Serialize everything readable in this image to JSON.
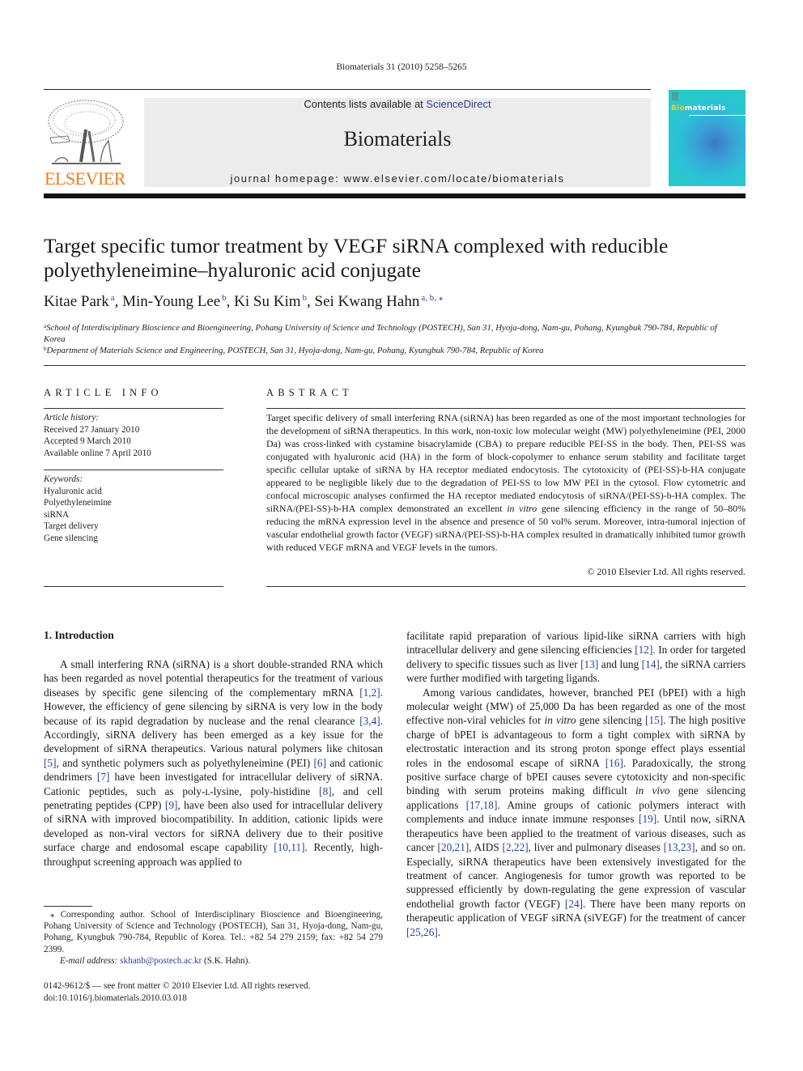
{
  "header": {
    "citation": "Biomaterials 31 (2010) 5258–5265",
    "contents_prefix": "Contents lists available at ",
    "contents_link": "ScienceDirect",
    "journal_name": "Biomaterials",
    "homepage": "journal homepage: www.elsevier.com/locate/biomaterials",
    "publisher_logo_text": "ELSEVIER",
    "cover_title_highlight": "Bio",
    "cover_title_rest": "materials",
    "colors": {
      "publisher_orange": "#f07c1a",
      "link_blue": "#2a3f9a",
      "masthead_bg": "#ececec",
      "cover_teal": "#28c4c6"
    }
  },
  "article": {
    "title_line1": "Target specific tumor treatment by VEGF siRNA complexed with reducible",
    "title_line2": "polyethyleneimine–hyaluronic acid conjugate",
    "authors": [
      {
        "name": "Kitae Park",
        "affil": "a"
      },
      {
        "name": "Min-Young Lee",
        "affil": "b"
      },
      {
        "name": "Ki Su Kim",
        "affil": "b"
      },
      {
        "name": "Sei Kwang Hahn",
        "affil": "a, b, ⁎"
      }
    ],
    "affiliations": [
      {
        "mark": "a",
        "text": "School of Interdisciplinary Bioscience and Bioengineering, Pohang University of Science and Technology (POSTECH), San 31, Hyoja-dong, Nam-gu, Pohang, Kyungbuk 790-784, Republic of Korea"
      },
      {
        "mark": "b",
        "text": "Department of Materials Science and Engineering, POSTECH, San 31, Hyoja-dong, Nam-gu, Pohang, Kyungbuk 790-784, Republic of Korea"
      }
    ]
  },
  "article_info": {
    "heading": "ARTICLE INFO",
    "history_label": "Article history:",
    "history": [
      "Received 27 January 2010",
      "Accepted 9 March 2010",
      "Available online 7 April 2010"
    ],
    "keywords_label": "Keywords:",
    "keywords": [
      "Hyaluronic acid",
      "Polyethyleneimine",
      "siRNA",
      "Target delivery",
      "Gene silencing"
    ]
  },
  "abstract": {
    "heading": "ABSTRACT",
    "text_part1": "Target specific delivery of small interfering RNA (siRNA) has been regarded as one of the most important technologies for the development of siRNA therapeutics. In this work, non-toxic low molecular weight (MW) polyethyleneimine (PEI, 2000 Da) was cross-linked with cystamine bisacrylamide (CBA) to prepare reducible PEI-SS in the body. Then, PEI-SS was conjugated with hyaluronic acid (HA) in the form of block-copolymer to enhance serum stability and facilitate target specific cellular uptake of siRNA by HA receptor mediated endocytosis. The cytotoxicity of (PEI-SS)-b-HA conjugate appeared to be negligible likely due to the degradation of PEI-SS to low MW PEI in the cytosol. Flow cytometric and confocal microscopic analyses confirmed the HA receptor mediated endocytosis of siRNA/(PEI-SS)-b-HA complex. The siRNA/(PEI-SS)-b-HA complex demonstrated an excellent ",
    "text_italic": "in vitro",
    "text_part2": " gene silencing efficiency in the range of 50–80% reducing the mRNA expression level in the absence and presence of 50 vol% serum. Moreover, intra-tumoral injection of vascular endothelial growth factor (VEGF) siRNA/(PEI-SS)-b-HA complex resulted in dramatically inhibited tumor growth with reduced VEGF mRNA and VEGF levels in the tumors.",
    "copyright": "© 2010 Elsevier Ltd. All rights reserved."
  },
  "introduction": {
    "heading": "1.  Introduction",
    "col1": [
      "A small interfering RNA (siRNA) is a short double-stranded RNA which has been regarded as novel potential therapeutics for the treatment of various diseases by specific gene silencing of the complementary mRNA ",
      "[1,2]",
      ". However, the efficiency of gene silencing by siRNA is very low in the body because of its rapid degradation by nuclease and the renal clearance ",
      "[3,4]",
      ". Accordingly, siRNA delivery has been emerged as a key issue for the development of siRNA therapeutics. Various natural polymers like chitosan ",
      "[5]",
      ", and synthetic polymers such as polyethyleneimine (PEI) ",
      "[6]",
      " and cationic dendrimers ",
      "[7]",
      " have been investigated for intracellular delivery of siRNA. Cationic peptides, such as poly-ʟ-lysine, poly-histidine ",
      "[8]",
      ", and cell penetrating peptides (CPP) ",
      "[9]",
      ", have been also used for intracellular delivery of siRNA with improved biocompatibility. In addition, cationic lipids were developed as non-viral vectors for siRNA delivery due to their positive surface charge and endosomal escape capability ",
      "[10,11]",
      ". Recently, high-throughput screening approach was applied to"
    ],
    "col2_para1": [
      "facilitate rapid preparation of various lipid-like siRNA carriers with high intracellular delivery and gene silencing efficiencies ",
      "[12]",
      ". In order for targeted delivery to specific tissues such as liver ",
      "[13]",
      " and lung ",
      "[14]",
      ", the siRNA carriers were further modified with targeting ligands."
    ],
    "col2_para2": [
      "Among various candidates, however, branched PEI (bPEI) with a high molecular weight (MW) of 25,000 Da has been regarded as one of the most effective non-viral vehicles for ",
      "in vitro",
      " gene silencing ",
      "[15]",
      ". The high positive charge of bPEI is advantageous to form a tight complex with siRNA by electrostatic interaction and its strong proton sponge effect plays essential roles in the endosomal escape of siRNA ",
      "[16]",
      ". Paradoxically, the strong positive surface charge of bPEI causes severe cytotoxicity and non-specific binding with serum proteins making difficult ",
      "in vivo",
      " gene silencing applications ",
      "[17,18]",
      ". Amine groups of cationic polymers interact with complements and induce innate immune responses ",
      "[19]",
      ". Until now, siRNA therapeutics have been applied to the treatment of various diseases, such as cancer ",
      "[20,21]",
      ", AIDS ",
      "[2,22]",
      ", liver and pulmonary diseases ",
      "[13,23]",
      ", and so on. Especially, siRNA therapeutics have been extensively investigated for the treatment of cancer. Angiogenesis for tumor growth was reported to be suppressed efficiently by down-regulating the gene expression of vascular endothelial growth factor (VEGF) ",
      "[24]",
      ". There have been many reports on therapeutic application of VEGF siRNA (siVEGF) for the treatment of cancer ",
      "[25,26]",
      "."
    ]
  },
  "footnote": {
    "corresponding": "⁎ Corresponding author. School of Interdisciplinary Bioscience and Bioengineering, Pohang University of Science and Technology (POSTECH), San 31, Hyoja-dong, Nam-gu, Pohang, Kyungbuk 790-784, Republic of Korea. Tel.: +82 54 279 2159; fax: +82 54 279 2399.",
    "email_label": "E-mail address:",
    "email": "skhanb@postech.ac.kr",
    "email_suffix": " (S.K. Hahn)."
  },
  "bottom_meta": {
    "issn_line": "0142-9612/$ — see front matter © 2010 Elsevier Ltd. All rights reserved.",
    "doi": "doi:10.1016/j.biomaterials.2010.03.018"
  }
}
